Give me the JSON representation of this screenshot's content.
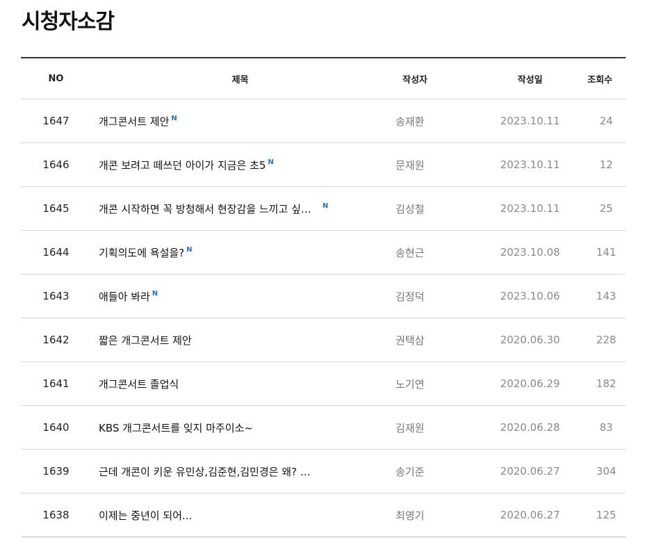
{
  "page": {
    "title": "시청자소감"
  },
  "board": {
    "columns": {
      "no": "NO",
      "title": "제목",
      "author": "작성자",
      "date": "작성일",
      "views": "조회수"
    },
    "new_badge": "N",
    "rows": [
      {
        "no": "1647",
        "title": "개그콘서트 제안",
        "is_new": true,
        "author": "송재환",
        "date": "2023.10.11",
        "views": "24"
      },
      {
        "no": "1646",
        "title": "개콘 보려고 떼쓰던 아이가 지금은 초5",
        "is_new": true,
        "author": "문재원",
        "date": "2023.10.11",
        "views": "12"
      },
      {
        "no": "1645",
        "title": "개콘 시작하면 꼭 방청해서 현장감을 느끼고 싶…",
        "is_new": true,
        "author": "김성철",
        "date": "2023.10.11",
        "views": "25"
      },
      {
        "no": "1644",
        "title": "기획의도에 욕설을?",
        "is_new": true,
        "author": "송현근",
        "date": "2023.10.08",
        "views": "141"
      },
      {
        "no": "1643",
        "title": "애들아 봐라",
        "is_new": true,
        "author": "김정덕",
        "date": "2023.10.06",
        "views": "143"
      },
      {
        "no": "1642",
        "title": "짧은 개그콘서트 제안",
        "is_new": false,
        "author": "권택삼",
        "date": "2020.06.30",
        "views": "228"
      },
      {
        "no": "1641",
        "title": "개그콘서트 졸업식",
        "is_new": false,
        "author": "노기연",
        "date": "2020.06.29",
        "views": "182"
      },
      {
        "no": "1640",
        "title": "KBS 개그콘서트를 잊지 마주이소~",
        "is_new": false,
        "author": "김재원",
        "date": "2020.06.28",
        "views": "83"
      },
      {
        "no": "1639",
        "title": "근데 개콘이 키운 유민상,김준현,김민경은 왜? …",
        "is_new": false,
        "author": "송기준",
        "date": "2020.06.27",
        "views": "304"
      },
      {
        "no": "1638",
        "title": "이제는 중년이 되어...",
        "is_new": false,
        "author": "최영기",
        "date": "2020.06.27",
        "views": "125"
      }
    ]
  },
  "colors": {
    "table_top_border": "#2d3046",
    "new_badge": "#1f6fd1",
    "row_divider": "#d8d8d8"
  }
}
